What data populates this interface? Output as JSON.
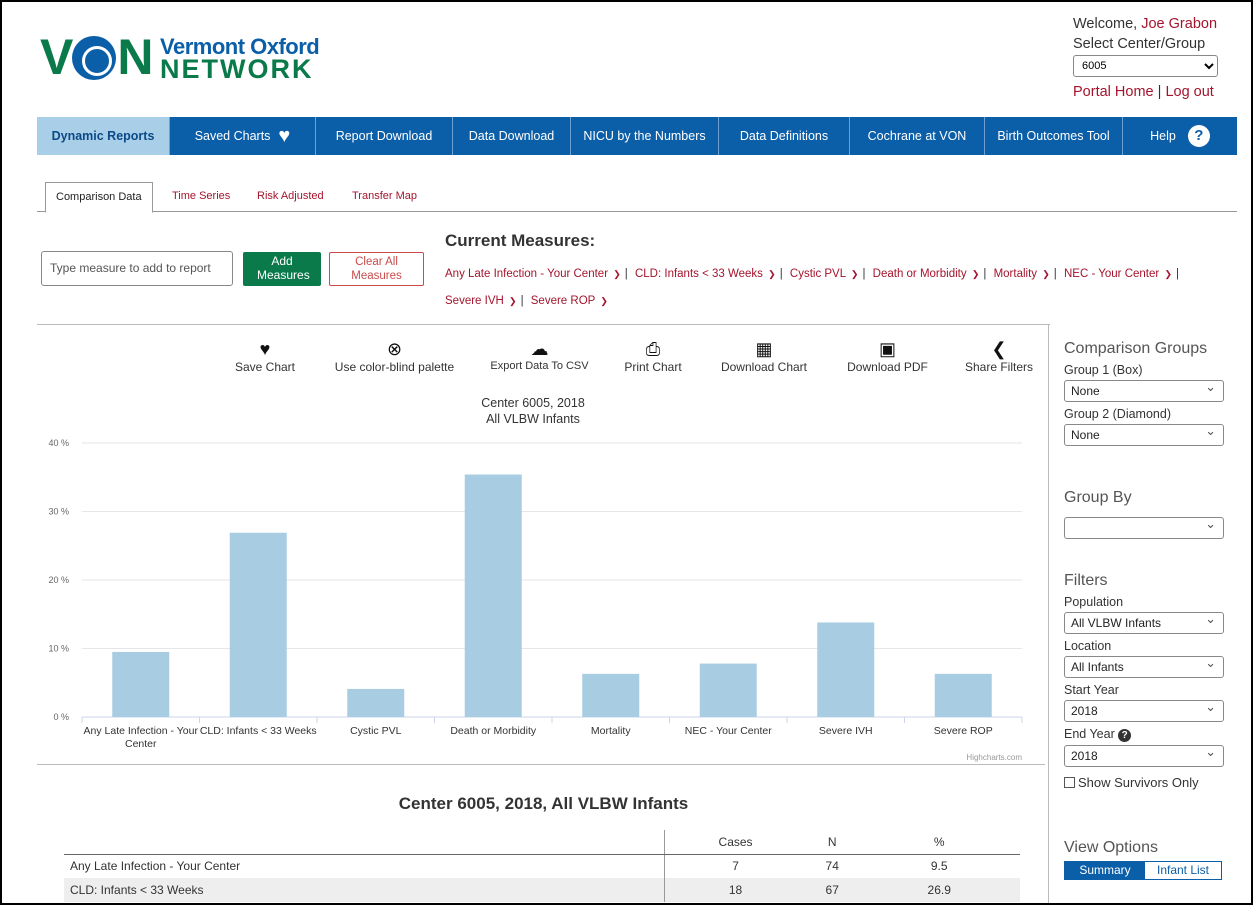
{
  "header": {
    "logo_mark": "VON",
    "logo_line1": "Vermont Oxford",
    "logo_line2": "NETWORK",
    "welcome_prefix": "Welcome,",
    "user_name": "Joe Grabon",
    "select_center_label": "Select Center/Group",
    "center_value": "6005",
    "portal_home": "Portal Home",
    "separator": "|",
    "logout": "Log out"
  },
  "nav": {
    "items": [
      {
        "label": "Dynamic Reports"
      },
      {
        "label": "Saved Charts"
      },
      {
        "label": "Report Download"
      },
      {
        "label": "Data Download"
      },
      {
        "label": "NICU by the Numbers"
      },
      {
        "label": "Data Definitions"
      },
      {
        "label": "Cochrane at VON"
      },
      {
        "label": "Birth Outcomes Tool"
      },
      {
        "label": "Help"
      }
    ],
    "help_glyph": "?"
  },
  "subtabs": [
    "Comparison Data",
    "Time Series",
    "Risk Adjusted",
    "Transfer Map"
  ],
  "measures": {
    "input_placeholder": "Type measure to add to report",
    "add_button": "Add Measures",
    "clear_button": "Clear All Measures",
    "current_title": "Current Measures:",
    "list": [
      "Any Late Infection - Your Center",
      "CLD: Infants < 33 Weeks",
      "Cystic PVL",
      "Death or Morbidity",
      "Mortality",
      "NEC - Your Center",
      "Severe IVH",
      "Severe ROP"
    ]
  },
  "toolbar": {
    "save_chart": "Save Chart",
    "color_blind": "Use color-blind palette",
    "export_csv": "Export Data To CSV",
    "print_chart": "Print Chart",
    "download_chart": "Download Chart",
    "download_pdf": "Download PDF",
    "share_filters": "Share Filters"
  },
  "chart_data": {
    "type": "bar",
    "title": "Center 6005, 2018",
    "subtitle": "All VLBW Infants",
    "categories": [
      "Any Late Infection - Your Center",
      "CLD: Infants < 33 Weeks",
      "Cystic PVL",
      "Death or Morbidity",
      "Mortality",
      "NEC - Your Center",
      "Severe IVH",
      "Severe ROP"
    ],
    "values": [
      9.5,
      26.9,
      4.1,
      35.4,
      6.3,
      7.8,
      13.8,
      6.3
    ],
    "ylim": [
      0,
      40
    ],
    "yticks": [
      "0 %",
      "10 %",
      "20 %",
      "30 %",
      "40 %"
    ],
    "grid": true,
    "bar_color": "#a8cde2",
    "credits": "Highcharts.com"
  },
  "table": {
    "title": "Center 6005, 2018, All VLBW Infants",
    "columns": [
      "",
      "Cases",
      "N",
      "%"
    ],
    "rows": [
      {
        "name": "Any Late Infection - Your Center",
        "cases": "7",
        "n": "74",
        "pct": "9.5"
      },
      {
        "name": "CLD: Infants < 33 Weeks",
        "cases": "18",
        "n": "67",
        "pct": "26.9"
      }
    ]
  },
  "right_panel": {
    "comparison_groups_title": "Comparison Groups",
    "group1_label": "Group 1 (Box)",
    "group1_value": "None",
    "group2_label": "Group 2 (Diamond)",
    "group2_value": "None",
    "group_by_title": "Group By",
    "group_by_value": "",
    "filters_title": "Filters",
    "population_label": "Population",
    "population_value": "All VLBW Infants",
    "location_label": "Location",
    "location_value": "All Infants",
    "start_year_label": "Start Year",
    "start_year_value": "2018",
    "end_year_label": "End Year",
    "end_year_value": "2018",
    "show_survivors": "Show Survivors Only",
    "view_options_title": "View Options",
    "view_summary": "Summary",
    "view_infant_list": "Infant List"
  },
  "colors": {
    "brand_blue": "#0b5ea8",
    "brand_green": "#0a7a4a",
    "link_red": "#a4142d"
  }
}
